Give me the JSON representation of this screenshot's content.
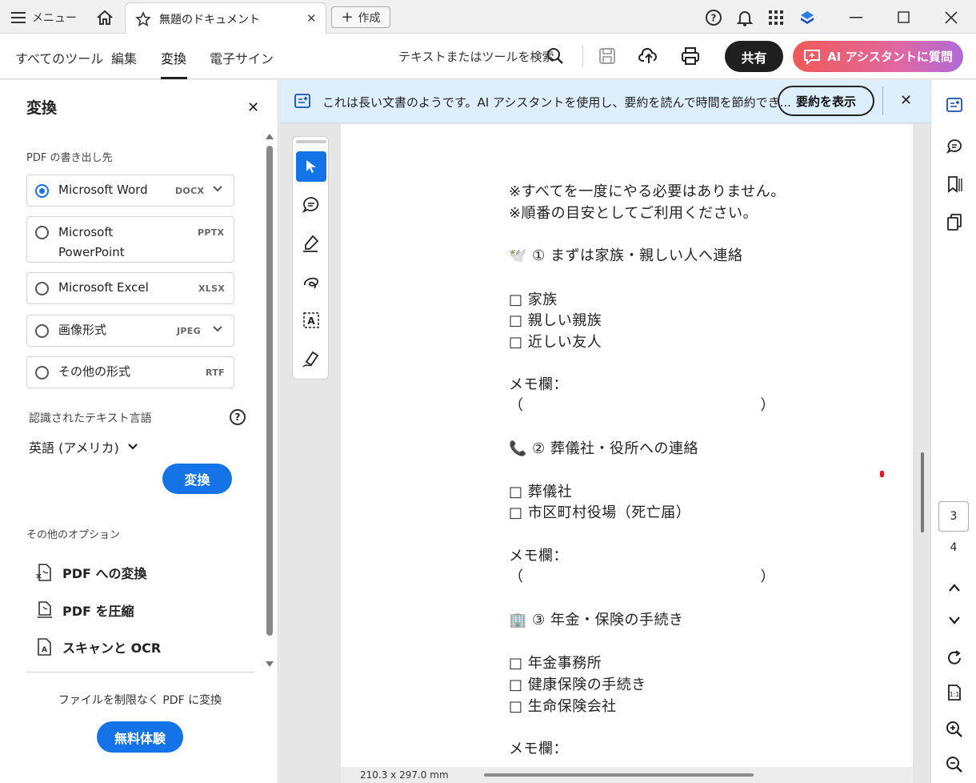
{
  "titlebar": {
    "menu_label": "メニュー",
    "tab_title": "無題のドキュメント",
    "create_label": "作成"
  },
  "toolbar": {
    "nav": [
      "すべてのツール",
      "編集",
      "変換",
      "電子サイン"
    ],
    "active_nav": "変換",
    "search_label": "テキストまたはツールを検索",
    "share_label": "共有",
    "ai_label": "AI アシスタントに質問"
  },
  "panel": {
    "title": "変換",
    "export_label": "PDF の書き出し先",
    "options": [
      {
        "label": "Microsoft Word",
        "ext": "DOCX",
        "selected": true,
        "dropdown": true
      },
      {
        "label": "Microsoft PowerPoint",
        "label_line1": "Microsoft",
        "label_line2": "PowerPoint",
        "ext": "PPTX",
        "selected": false,
        "dropdown": false
      },
      {
        "label": "Microsoft Excel",
        "ext": "XLSX",
        "selected": false,
        "dropdown": false
      },
      {
        "label": "画像形式",
        "ext": "JPEG",
        "selected": false,
        "dropdown": true
      },
      {
        "label": "その他の形式",
        "ext": "RTF",
        "selected": false,
        "dropdown": false
      }
    ],
    "lang_label": "認識されたテキスト言語",
    "lang_value": "英語 (アメリカ)",
    "convert_label": "変換",
    "more_label": "その他のオプション",
    "more_items": [
      "PDF への変換",
      "PDF を圧縮",
      "スキャンと OCR"
    ],
    "promo_text": "ファイルを制限なく PDF に変換",
    "trial_label": "無料体験"
  },
  "banner": {
    "text": "これは長い文書のようです。AI アシスタントを使用し、要約を読んで時間を節約でき...",
    "button": "要約を表示"
  },
  "document": {
    "lines": [
      "※すべてを一度にやる必要はありません。",
      "※順番の目安としてご利用ください。",
      "🕊️ ① まずは家族・親しい人へ連絡",
      "□ 家族",
      "□ 親しい親族",
      "□ 近しい友人",
      "メモ欄：",
      "（　　　　　　　　　　　　　　　　）",
      "📞 ② 葬儀社・役所への連絡",
      "□ 葬儀社",
      "□ 市区町村役場（死亡届）",
      "メモ欄：",
      "（　　　　　　　　　　　　　　　　）",
      "🏢 ③ 年金・保険の手続き",
      "□ 年金事務所",
      "□ 健康保険の手続き",
      "□ 生命保険会社",
      "メモ欄："
    ],
    "page_size": "210.3 x 297.0 mm"
  },
  "rightrail": {
    "current_page": "3",
    "next_page": "4"
  },
  "colors": {
    "accent": "#1473e6",
    "banner_bg": "#ddeefc",
    "share_bg": "#1f1f1f"
  }
}
